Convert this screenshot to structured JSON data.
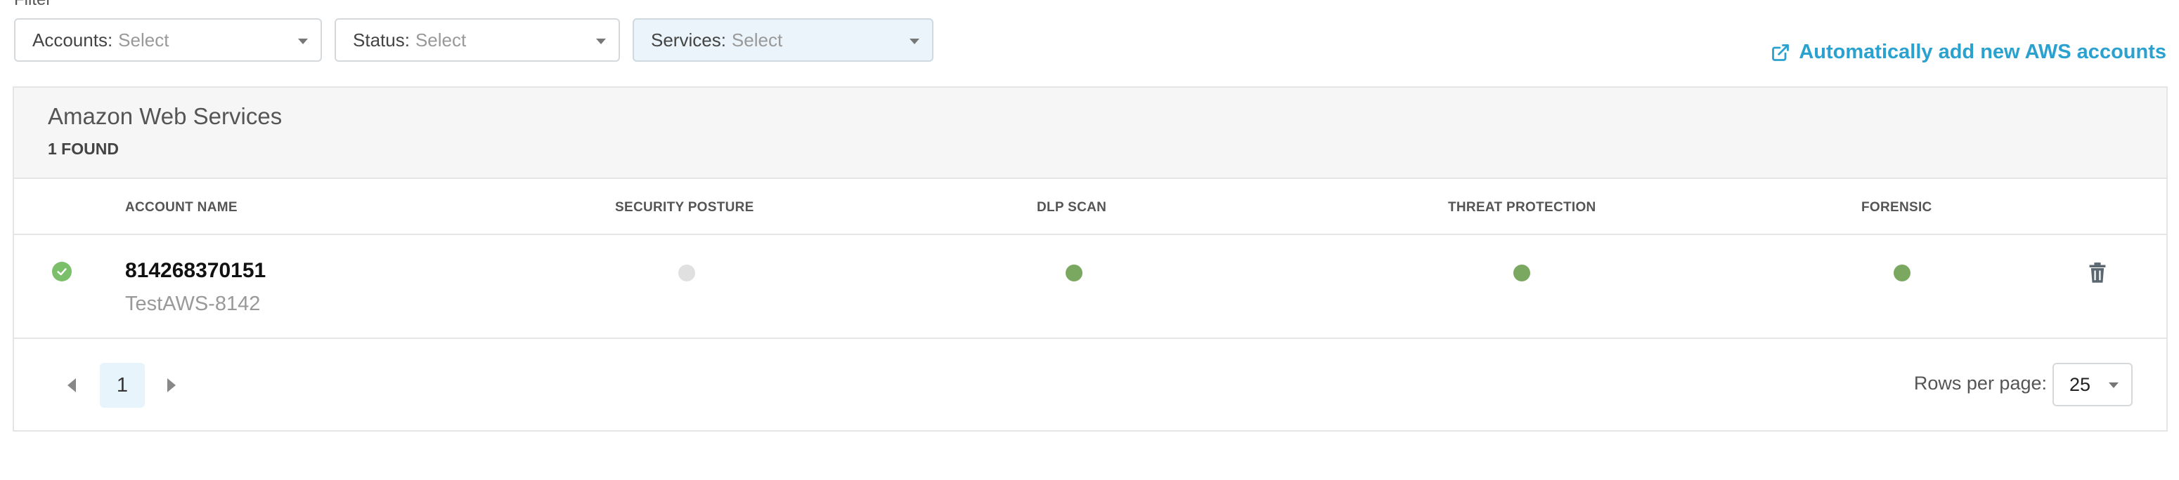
{
  "filters": {
    "heading": "Filter",
    "accounts": {
      "label": "Accounts:",
      "value": "Select"
    },
    "status": {
      "label": "Status:",
      "value": "Select"
    },
    "services": {
      "label": "Services:",
      "value": "Select"
    }
  },
  "auto_add_link": "Automatically add new AWS accounts",
  "panel": {
    "title": "Amazon Web Services",
    "count": "1 FOUND",
    "columns": {
      "account_name": "ACCOUNT NAME",
      "security_posture": "SECURITY POSTURE",
      "dlp_scan": "DLP SCAN",
      "threat_protection": "THREAT PROTECTION",
      "forensic": "FORENSIC"
    },
    "rows": [
      {
        "account_number": "814268370151",
        "account_alias": "TestAWS-8142",
        "security_posture": "inactive",
        "dlp_scan": "active",
        "threat_protection": "active",
        "forensic": "active"
      }
    ]
  },
  "pagination": {
    "current_page": "1",
    "rows_per_page_label": "Rows per page:",
    "rows_per_page": "25"
  },
  "colors": {
    "accent": "#2aa1cf",
    "status_active": "#7aa860",
    "status_inactive": "#e0e0e0",
    "check": "#7bbf6a"
  }
}
